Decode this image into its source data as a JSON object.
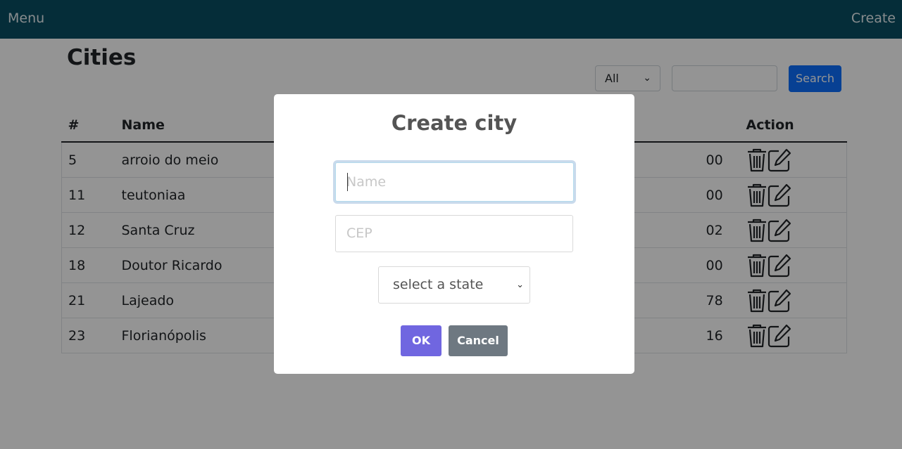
{
  "nav": {
    "menu_label": "Menu",
    "create_label": "Create"
  },
  "page": {
    "title": "Cities"
  },
  "filter": {
    "selected": "All",
    "search_value": "",
    "search_button": "Search"
  },
  "table": {
    "headers": {
      "id": "#",
      "name": "Name",
      "action": "Action"
    },
    "rows": [
      {
        "id": "5",
        "name": "arroio do meio",
        "partial": "00"
      },
      {
        "id": "11",
        "name": "teutoniaa",
        "partial": "00"
      },
      {
        "id": "12",
        "name": "Santa Cruz",
        "partial": "02"
      },
      {
        "id": "18",
        "name": "Doutor Ricardo",
        "partial": "00"
      },
      {
        "id": "21",
        "name": "Lajeado",
        "partial": "78"
      },
      {
        "id": "23",
        "name": "Florianópolis",
        "partial": "16"
      }
    ]
  },
  "modal": {
    "title": "Create city",
    "name_placeholder": "Name",
    "cep_placeholder": "CEP",
    "state_selected": "select a state",
    "ok_label": "OK",
    "cancel_label": "Cancel"
  },
  "icons": {
    "delete": "trash-icon",
    "edit": "edit-icon"
  },
  "colors": {
    "navbar": "#0a4f63",
    "primary": "#0d6efd",
    "ok": "#7066e0",
    "cancel": "#6e7881"
  }
}
